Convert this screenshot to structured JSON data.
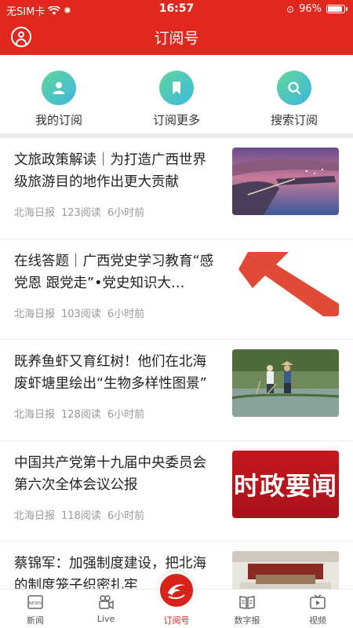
{
  "status_bar": {
    "carrier": "无SIM卡",
    "time": "16:57",
    "battery": "96%",
    "battery_level": 0.96
  },
  "header": {
    "title": "订阅号"
  },
  "actions": [
    {
      "label": "我的订阅",
      "icon": "user-icon"
    },
    {
      "label": "订阅更多",
      "icon": "bookmark-icon"
    },
    {
      "label": "搜索订阅",
      "icon": "search-icon"
    }
  ],
  "articles": [
    {
      "title": "文旅政策解读｜为打造广西世界级旅游目的地作出更大贡献",
      "source": "北海日报",
      "reads": "123阅读",
      "time": "6小时前",
      "thumb": "coastal-aerial"
    },
    {
      "title": "在线答题｜广西党史学习教育“感党恩 跟党走”•党史知识大…",
      "source": "北海日报",
      "reads": "103阅读",
      "time": "6小时前",
      "thumb": "red-arrow"
    },
    {
      "title": "既养鱼虾又育红树！他们在北海废虾塘里绘出“生物多样性图景”",
      "source": "北海日报",
      "reads": "128阅读",
      "time": "6小时前",
      "thumb": "mangrove-workers"
    },
    {
      "title": "中国共产党第十九届中央委员会第六次全体会议公报",
      "source": "北海日报",
      "reads": "118阅读",
      "time": "6小时前",
      "thumb": "politics-banner",
      "thumb_text": "时政要闻"
    },
    {
      "title": "蔡锦军：加强制度建设，把北海的制度笼子织密扎牢",
      "source": "",
      "reads": "",
      "time": "",
      "thumb": "meeting-room"
    }
  ],
  "tabs": [
    {
      "label": "新闻",
      "icon": "news-icon",
      "active": false
    },
    {
      "label": "Live",
      "icon": "video-camera-icon",
      "active": false
    },
    {
      "label": "订阅号",
      "icon": "dolphin-logo-icon",
      "active": true
    },
    {
      "label": "数字报",
      "icon": "newspaper-icon",
      "active": false
    },
    {
      "label": "视频",
      "icon": "tv-play-icon",
      "active": false
    }
  ],
  "colors": {
    "brand_red": "#e0281e",
    "active_tab": "#d8231b",
    "meta_gray": "#999999"
  }
}
